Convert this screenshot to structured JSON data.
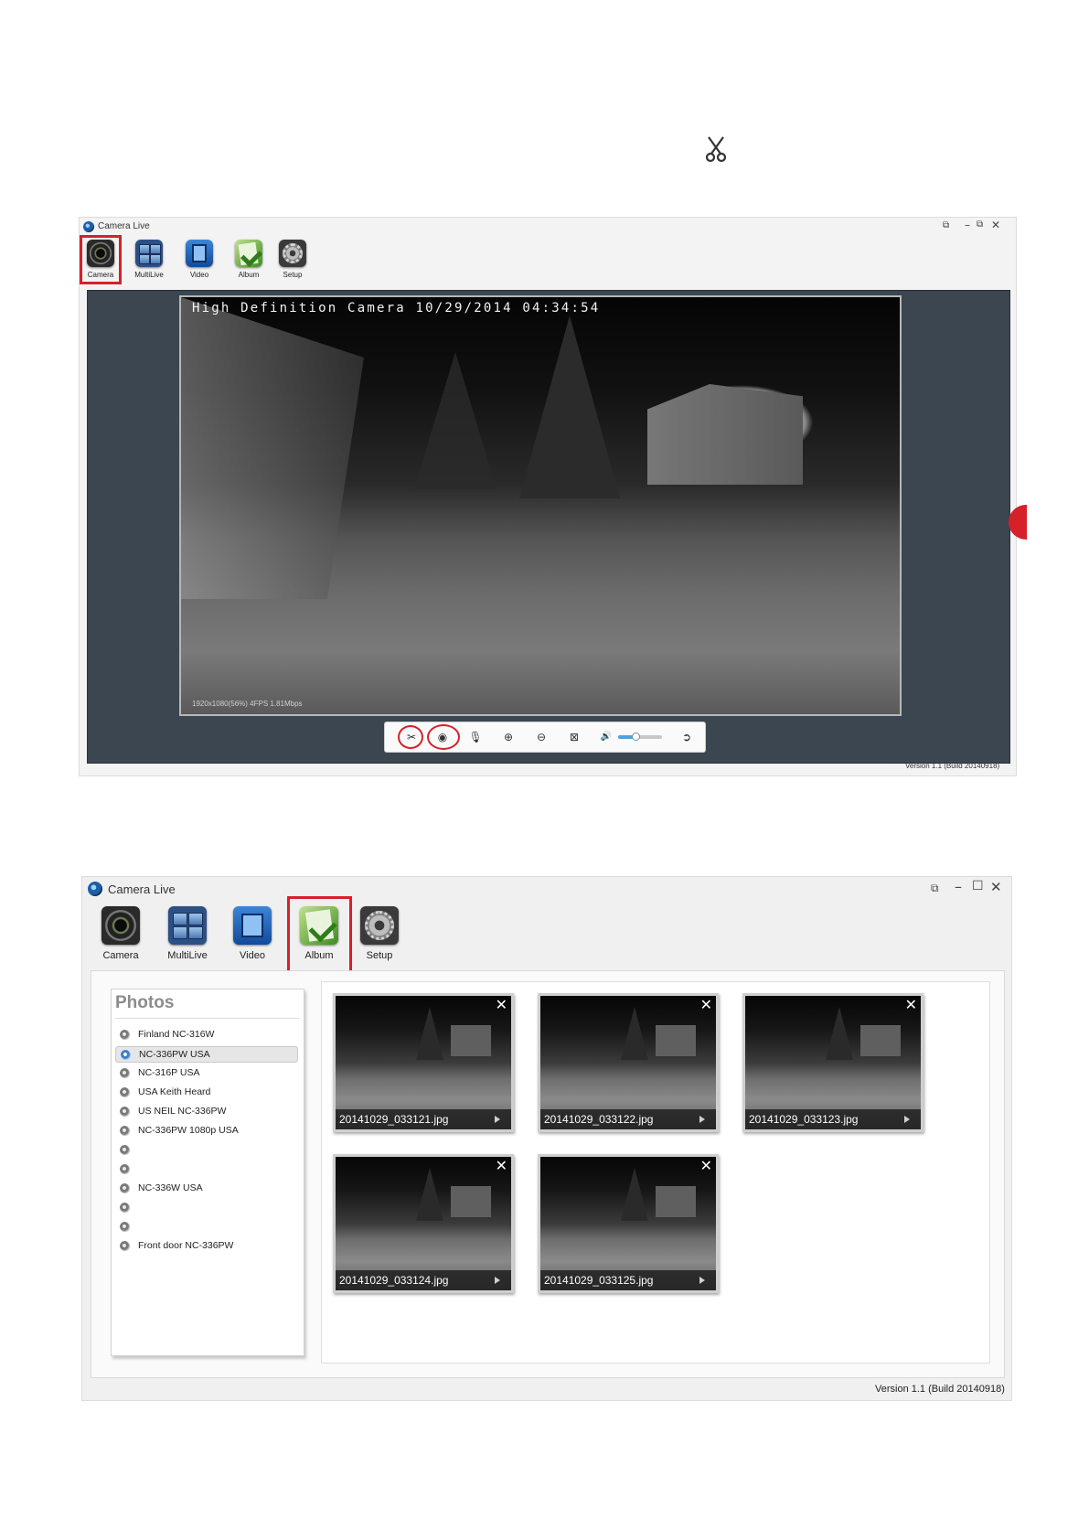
{
  "page": {
    "top_icon": "scissors-icon"
  },
  "camera_window": {
    "title": "Camera Live",
    "window_controls": [
      "restore-icon",
      "minimize-icon",
      "maximize-icon",
      "close-icon"
    ],
    "toolbar": [
      {
        "label": "Camera",
        "icon": "camera-icon",
        "highlighted": true
      },
      {
        "label": "MultiLive",
        "icon": "multilive-icon",
        "highlighted": false
      },
      {
        "label": "Video",
        "icon": "video-icon",
        "highlighted": false
      },
      {
        "label": "Album",
        "icon": "album-icon",
        "highlighted": false
      },
      {
        "label": "Setup",
        "icon": "setup-icon",
        "highlighted": false
      }
    ],
    "video": {
      "osd": "High Definition Camera 10/29/2014 04:34:54",
      "stats": "1920x1080(56%)  4FPS 1.81Mbps"
    },
    "controls": [
      {
        "icon": "scissors-icon",
        "circled": true
      },
      {
        "icon": "record-icon",
        "circled": true
      },
      {
        "icon": "microphone-icon",
        "circled": false
      },
      {
        "icon": "zoom-in-icon",
        "circled": false
      },
      {
        "icon": "zoom-out-icon",
        "circled": false
      },
      {
        "icon": "fullscreen-icon",
        "circled": false
      },
      {
        "icon": "speaker-icon",
        "circled": false
      },
      {
        "icon": "ptz-icon",
        "circled": false
      }
    ],
    "volume_level": 0.4,
    "version": "Version 1.1 (Build 20140918)"
  },
  "album_window": {
    "title": "Camera Live",
    "window_controls": [
      "restore-icon",
      "minimize-icon",
      "maximize-icon",
      "close-icon"
    ],
    "toolbar": [
      {
        "label": "Camera",
        "icon": "camera-icon",
        "highlighted": false
      },
      {
        "label": "MultiLive",
        "icon": "multilive-icon",
        "highlighted": false
      },
      {
        "label": "Video",
        "icon": "video-icon",
        "highlighted": false
      },
      {
        "label": "Album",
        "icon": "album-icon",
        "highlighted": true
      },
      {
        "label": "Setup",
        "icon": "setup-icon",
        "highlighted": false
      }
    ],
    "photos_title": "Photos",
    "devices": [
      {
        "name": "Finland NC-316W",
        "selected": false
      },
      {
        "name": "NC-336PW USA",
        "selected": true
      },
      {
        "name": "NC-316P USA",
        "selected": false
      },
      {
        "name": "USA Keith Heard",
        "selected": false
      },
      {
        "name": "US NEIL NC-336PW",
        "selected": false
      },
      {
        "name": "NC-336PW 1080p USA",
        "selected": false
      },
      {
        "name": "",
        "selected": false
      },
      {
        "name": "",
        "selected": false
      },
      {
        "name": "NC-336W USA",
        "selected": false
      },
      {
        "name": "",
        "selected": false
      },
      {
        "name": "",
        "selected": false
      },
      {
        "name": "Front door NC-336PW",
        "selected": false
      }
    ],
    "thumbnails": [
      {
        "filename": "20141029_033121.jpg"
      },
      {
        "filename": "20141029_033122.jpg"
      },
      {
        "filename": "20141029_033123.jpg"
      },
      {
        "filename": "20141029_033124.jpg"
      },
      {
        "filename": "20141029_033125.jpg"
      }
    ],
    "version": "Version 1.1 (Build 20140918)"
  }
}
